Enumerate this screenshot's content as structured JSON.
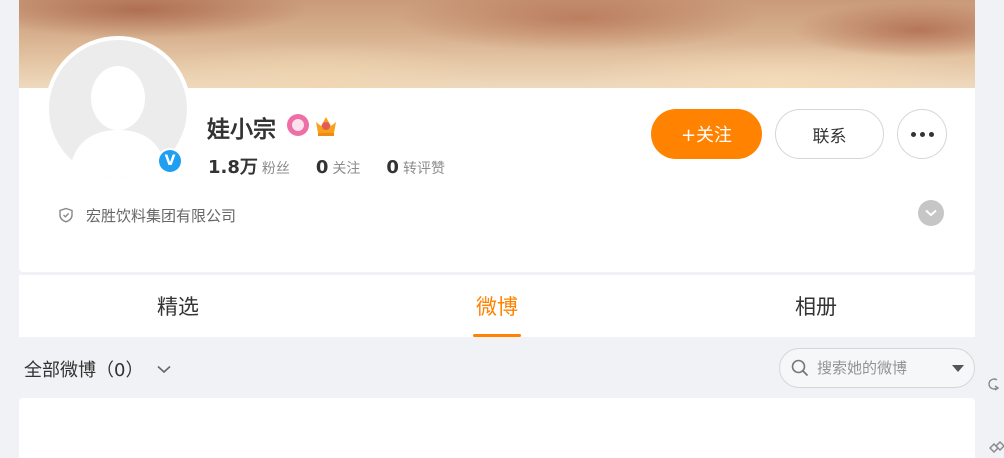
{
  "profile": {
    "name": "娃小宗",
    "verified_mark": "V",
    "stats": [
      {
        "value": "1.8万",
        "label": "粉丝"
      },
      {
        "value": "0",
        "label": "关注"
      },
      {
        "value": "0",
        "label": "转评赞"
      }
    ],
    "company": "宏胜饮料集团有限公司"
  },
  "actions": {
    "follow_label": "+关注",
    "contact_label": "联系"
  },
  "tabs": [
    {
      "label": "精选",
      "active": false
    },
    {
      "label": "微博",
      "active": true
    },
    {
      "label": "相册",
      "active": false
    }
  ],
  "filter": {
    "label": "全部微博（0）"
  },
  "search": {
    "placeholder": "搜索她的微博"
  },
  "colors": {
    "accent": "#ff8200",
    "verify": "#1e9ff2",
    "page_bg": "#f1f2f5"
  },
  "icons": [
    "avatar-placeholder-icon",
    "verified-icon",
    "vip-badge-icon",
    "crown-icon",
    "more-icon",
    "shield-icon",
    "chevron-down-icon",
    "search-icon",
    "dropdown-caret-icon"
  ]
}
